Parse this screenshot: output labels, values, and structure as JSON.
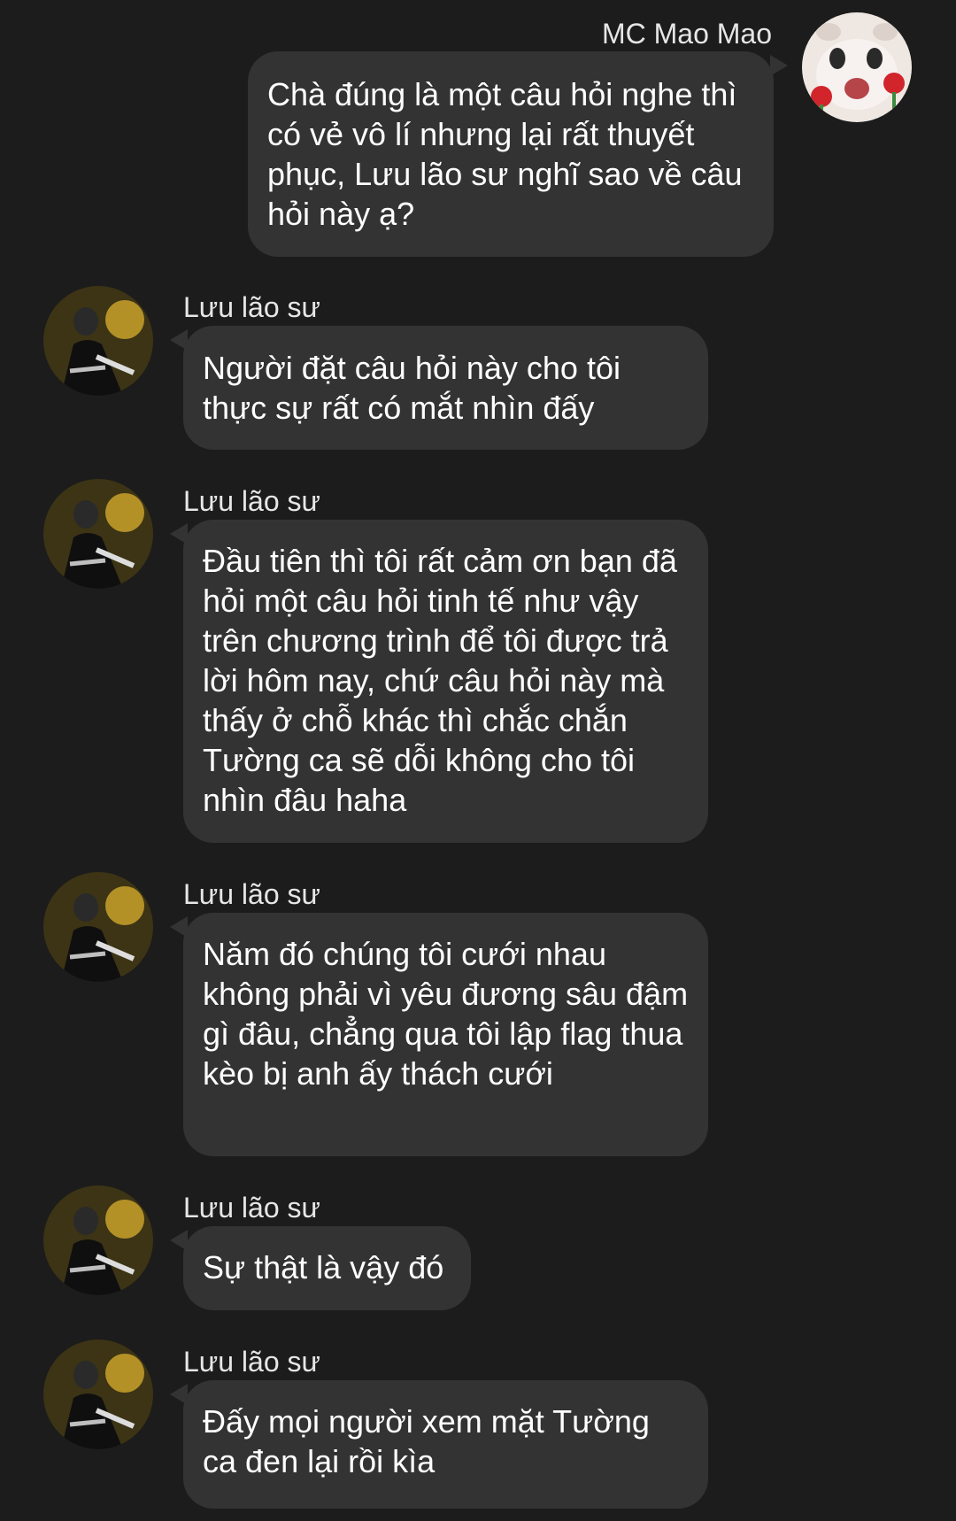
{
  "app": {
    "background_color": "#1c1c1c",
    "bubble_color": "#333333"
  },
  "messages": [
    {
      "sender": "MC Mao Mao",
      "side": "right",
      "avatar_icon": "cat-sticker-avatar",
      "text": "Chà đúng là một câu hỏi nghe thì có vẻ vô lí nhưng lại rất thuyết phục, Lưu lão sư nghĩ sao về câu hỏi này ạ?"
    },
    {
      "sender": "Lưu lão sư",
      "side": "left",
      "avatar_icon": "person-photo-avatar",
      "text": "Người đặt câu hỏi này cho tôi thực sự rất có mắt nhìn đấy"
    },
    {
      "sender": "Lưu lão sư",
      "side": "left",
      "avatar_icon": "person-photo-avatar",
      "text": "Đầu tiên thì tôi rất cảm ơn bạn đã hỏi một câu hỏi tinh tế như vậy trên chương trình để tôi được trả lời hôm nay, chứ câu hỏi này mà thấy ở chỗ khác thì chắc chắn Tường ca sẽ dỗi không cho tôi nhìn đâu haha"
    },
    {
      "sender": "Lưu lão sư",
      "side": "left",
      "avatar_icon": "person-photo-avatar",
      "text": "Năm đó chúng tôi cưới nhau không phải vì yêu đương sâu đậm gì đâu, chẳng qua tôi lập flag thua kèo bị anh ấy thách cưới"
    },
    {
      "sender": "Lưu lão sư",
      "side": "left",
      "avatar_icon": "person-photo-avatar",
      "text": "Sự thật là vậy đó"
    },
    {
      "sender": "Lưu lão sư",
      "side": "left",
      "avatar_icon": "person-photo-avatar",
      "text": "Đấy mọi người xem mặt Tường ca đen lại rồi kìa"
    }
  ]
}
